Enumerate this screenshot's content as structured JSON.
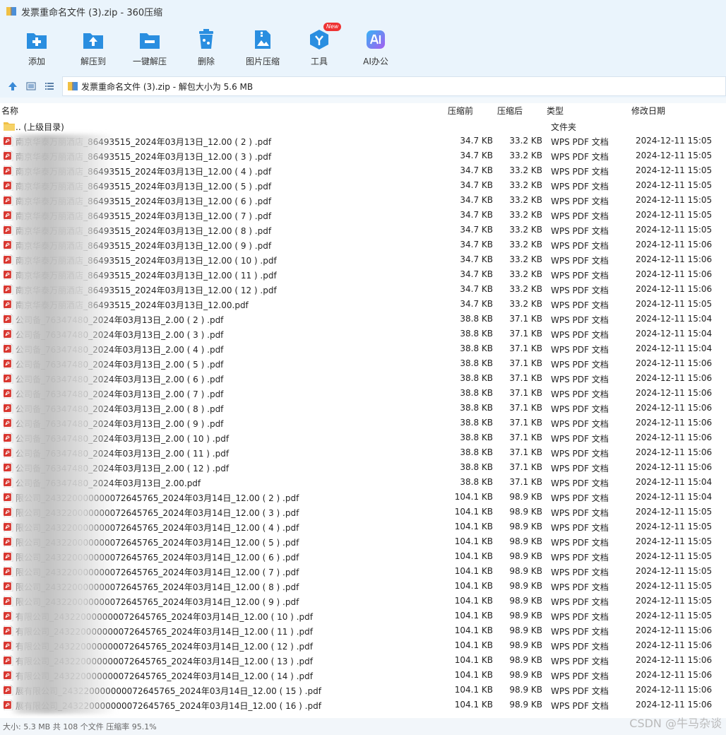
{
  "window": {
    "title": "发票重命名文件 (3).zip - 360压缩"
  },
  "toolbar": {
    "items": [
      {
        "label": "添加",
        "icon": "add-icon"
      },
      {
        "label": "解压到",
        "icon": "extract-to-icon"
      },
      {
        "label": "一键解压",
        "icon": "one-click-extract-icon"
      },
      {
        "label": "删除",
        "icon": "delete-icon"
      },
      {
        "label": "图片压缩",
        "icon": "image-compress-icon"
      },
      {
        "label": "工具",
        "icon": "tools-icon",
        "badge": "New"
      },
      {
        "label": "AI办公",
        "icon": "ai-office-icon"
      }
    ]
  },
  "address": {
    "path": "发票重命名文件 (3).zip - 解包大小为 5.6 MB"
  },
  "columns": {
    "name": "名称",
    "packed": "压缩前",
    "compressed": "压缩后",
    "type": "类型",
    "modified": "修改日期"
  },
  "files": [
    {
      "name": ".. (上级目录)",
      "csize": "",
      "usize": "",
      "type": "文件夹",
      "date": "",
      "folder": true
    },
    {
      "name": "南京华泰万丽酒店_86493515_2024年03月13日_12.00 ( 2 ) .pdf",
      "csize": "34.7 KB",
      "usize": "33.2 KB",
      "type": "WPS PDF 文档",
      "date": "2024-12-11 15:05"
    },
    {
      "name": "南京华泰万丽酒店_86493515_2024年03月13日_12.00 ( 3 ) .pdf",
      "csize": "34.7 KB",
      "usize": "33.2 KB",
      "type": "WPS PDF 文档",
      "date": "2024-12-11 15:05"
    },
    {
      "name": "南京华泰万丽酒店_86493515_2024年03月13日_12.00 ( 4 ) .pdf",
      "csize": "34.7 KB",
      "usize": "33.2 KB",
      "type": "WPS PDF 文档",
      "date": "2024-12-11 15:05"
    },
    {
      "name": "南京华泰万丽酒店_86493515_2024年03月13日_12.00 ( 5 ) .pdf",
      "csize": "34.7 KB",
      "usize": "33.2 KB",
      "type": "WPS PDF 文档",
      "date": "2024-12-11 15:05"
    },
    {
      "name": "南京华泰万丽酒店_86493515_2024年03月13日_12.00 ( 6 ) .pdf",
      "csize": "34.7 KB",
      "usize": "33.2 KB",
      "type": "WPS PDF 文档",
      "date": "2024-12-11 15:05"
    },
    {
      "name": "南京华泰万丽酒店_86493515_2024年03月13日_12.00 ( 7 ) .pdf",
      "csize": "34.7 KB",
      "usize": "33.2 KB",
      "type": "WPS PDF 文档",
      "date": "2024-12-11 15:05"
    },
    {
      "name": "南京华泰万丽酒店_86493515_2024年03月13日_12.00 ( 8 ) .pdf",
      "csize": "34.7 KB",
      "usize": "33.2 KB",
      "type": "WPS PDF 文档",
      "date": "2024-12-11 15:05"
    },
    {
      "name": "南京华泰万丽酒店_86493515_2024年03月13日_12.00 ( 9 ) .pdf",
      "csize": "34.7 KB",
      "usize": "33.2 KB",
      "type": "WPS PDF 文档",
      "date": "2024-12-11 15:06"
    },
    {
      "name": "南京华泰万丽酒店_86493515_2024年03月13日_12.00 ( 10 ) .pdf",
      "csize": "34.7 KB",
      "usize": "33.2 KB",
      "type": "WPS PDF 文档",
      "date": "2024-12-11 15:06"
    },
    {
      "name": "南京华泰万丽酒店_86493515_2024年03月13日_12.00 ( 11 ) .pdf",
      "csize": "34.7 KB",
      "usize": "33.2 KB",
      "type": "WPS PDF 文档",
      "date": "2024-12-11 15:06"
    },
    {
      "name": "南京华泰万丽酒店_86493515_2024年03月13日_12.00 ( 12 ) .pdf",
      "csize": "34.7 KB",
      "usize": "33.2 KB",
      "type": "WPS PDF 文档",
      "date": "2024-12-11 15:06"
    },
    {
      "name": "南京华泰万丽酒店_86493515_2024年03月13日_12.00.pdf",
      "csize": "34.7 KB",
      "usize": "33.2 KB",
      "type": "WPS PDF 文档",
      "date": "2024-12-11 15:05"
    },
    {
      "name": "公司备_76347480_2024年03月13日_2.00 ( 2 ) .pdf",
      "csize": "38.8 KB",
      "usize": "37.1 KB",
      "type": "WPS PDF 文档",
      "date": "2024-12-11 15:04"
    },
    {
      "name": "公司备_76347480_2024年03月13日_2.00 ( 3 ) .pdf",
      "csize": "38.8 KB",
      "usize": "37.1 KB",
      "type": "WPS PDF 文档",
      "date": "2024-12-11 15:04"
    },
    {
      "name": "公司备_76347480_2024年03月13日_2.00 ( 4 ) .pdf",
      "csize": "38.8 KB",
      "usize": "37.1 KB",
      "type": "WPS PDF 文档",
      "date": "2024-12-11 15:04"
    },
    {
      "name": "公司备_76347480_2024年03月13日_2.00 ( 5 ) .pdf",
      "csize": "38.8 KB",
      "usize": "37.1 KB",
      "type": "WPS PDF 文档",
      "date": "2024-12-11 15:06"
    },
    {
      "name": "公司备_76347480_2024年03月13日_2.00 ( 6 ) .pdf",
      "csize": "38.8 KB",
      "usize": "37.1 KB",
      "type": "WPS PDF 文档",
      "date": "2024-12-11 15:06"
    },
    {
      "name": "公司备_76347480_2024年03月13日_2.00 ( 7 ) .pdf",
      "csize": "38.8 KB",
      "usize": "37.1 KB",
      "type": "WPS PDF 文档",
      "date": "2024-12-11 15:06"
    },
    {
      "name": "公司备_76347480_2024年03月13日_2.00 ( 8 ) .pdf",
      "csize": "38.8 KB",
      "usize": "37.1 KB",
      "type": "WPS PDF 文档",
      "date": "2024-12-11 15:06"
    },
    {
      "name": "公司备_76347480_2024年03月13日_2.00 ( 9 ) .pdf",
      "csize": "38.8 KB",
      "usize": "37.1 KB",
      "type": "WPS PDF 文档",
      "date": "2024-12-11 15:06"
    },
    {
      "name": "公司备_76347480_2024年03月13日_2.00 ( 10 ) .pdf",
      "csize": "38.8 KB",
      "usize": "37.1 KB",
      "type": "WPS PDF 文档",
      "date": "2024-12-11 15:06"
    },
    {
      "name": "公司备_76347480_2024年03月13日_2.00 ( 11 ) .pdf",
      "csize": "38.8 KB",
      "usize": "37.1 KB",
      "type": "WPS PDF 文档",
      "date": "2024-12-11 15:06"
    },
    {
      "name": "公司备_76347480_2024年03月13日_2.00 ( 12 ) .pdf",
      "csize": "38.8 KB",
      "usize": "37.1 KB",
      "type": "WPS PDF 文档",
      "date": "2024-12-11 15:06"
    },
    {
      "name": "公司备_76347480_2024年03月13日_2.00.pdf",
      "csize": "38.8 KB",
      "usize": "37.1 KB",
      "type": "WPS PDF 文档",
      "date": "2024-12-11 15:04"
    },
    {
      "name": "限公司_243220000000072645765_2024年03月14日_12.00 ( 2 ) .pdf",
      "csize": "104.1 KB",
      "usize": "98.9 KB",
      "type": "WPS PDF 文档",
      "date": "2024-12-11 15:04"
    },
    {
      "name": "限公司_243220000000072645765_2024年03月14日_12.00 ( 3 ) .pdf",
      "csize": "104.1 KB",
      "usize": "98.9 KB",
      "type": "WPS PDF 文档",
      "date": "2024-12-11 15:05"
    },
    {
      "name": "限公司_243220000000072645765_2024年03月14日_12.00 ( 4 ) .pdf",
      "csize": "104.1 KB",
      "usize": "98.9 KB",
      "type": "WPS PDF 文档",
      "date": "2024-12-11 15:05"
    },
    {
      "name": "限公司_243220000000072645765_2024年03月14日_12.00 ( 5 ) .pdf",
      "csize": "104.1 KB",
      "usize": "98.9 KB",
      "type": "WPS PDF 文档",
      "date": "2024-12-11 15:05"
    },
    {
      "name": "限公司_243220000000072645765_2024年03月14日_12.00 ( 6 ) .pdf",
      "csize": "104.1 KB",
      "usize": "98.9 KB",
      "type": "WPS PDF 文档",
      "date": "2024-12-11 15:05"
    },
    {
      "name": "限公司_243220000000072645765_2024年03月14日_12.00 ( 7 ) .pdf",
      "csize": "104.1 KB",
      "usize": "98.9 KB",
      "type": "WPS PDF 文档",
      "date": "2024-12-11 15:05"
    },
    {
      "name": "限公司_243220000000072645765_2024年03月14日_12.00 ( 8 ) .pdf",
      "csize": "104.1 KB",
      "usize": "98.9 KB",
      "type": "WPS PDF 文档",
      "date": "2024-12-11 15:05"
    },
    {
      "name": "限公司_243220000000072645765_2024年03月14日_12.00 ( 9 ) .pdf",
      "csize": "104.1 KB",
      "usize": "98.9 KB",
      "type": "WPS PDF 文档",
      "date": "2024-12-11 15:05"
    },
    {
      "name": "有限公司_243220000000072645765_2024年03月14日_12.00 ( 10 ) .pdf",
      "csize": "104.1 KB",
      "usize": "98.9 KB",
      "type": "WPS PDF 文档",
      "date": "2024-12-11 15:05"
    },
    {
      "name": "有限公司_243220000000072645765_2024年03月14日_12.00 ( 11 ) .pdf",
      "csize": "104.1 KB",
      "usize": "98.9 KB",
      "type": "WPS PDF 文档",
      "date": "2024-12-11 15:06"
    },
    {
      "name": "有限公司_243220000000072645765_2024年03月14日_12.00 ( 12 ) .pdf",
      "csize": "104.1 KB",
      "usize": "98.9 KB",
      "type": "WPS PDF 文档",
      "date": "2024-12-11 15:06"
    },
    {
      "name": "有限公司_243220000000072645765_2024年03月14日_12.00 ( 13 ) .pdf",
      "csize": "104.1 KB",
      "usize": "98.9 KB",
      "type": "WPS PDF 文档",
      "date": "2024-12-11 15:06"
    },
    {
      "name": "有限公司_243220000000072645765_2024年03月14日_12.00 ( 14 ) .pdf",
      "csize": "104.1 KB",
      "usize": "98.9 KB",
      "type": "WPS PDF 文档",
      "date": "2024-12-11 15:06"
    },
    {
      "name": "展有限公司_243220000000072645765_2024年03月14日_12.00 ( 15 ) .pdf",
      "csize": "104.1 KB",
      "usize": "98.9 KB",
      "type": "WPS PDF 文档",
      "date": "2024-12-11 15:06"
    },
    {
      "name": "展有限公司_243220000000072645765_2024年03月14日_12.00 ( 16 ) .pdf",
      "csize": "104.1 KB",
      "usize": "98.9 KB",
      "type": "WPS PDF 文档",
      "date": "2024-12-11 15:06"
    }
  ],
  "status": {
    "text": "大小: 5.3 MB 共 108 个文件 压缩率 95.1%"
  },
  "watermark": "CSDN @牛马杂谈",
  "colors": {
    "chrome_bg": "#eaf4fc",
    "icon_blue": "#2a8ee0",
    "pdf_red": "#d9362f",
    "folder_yellow": "#f0c044",
    "badge_red": "#e33333"
  }
}
